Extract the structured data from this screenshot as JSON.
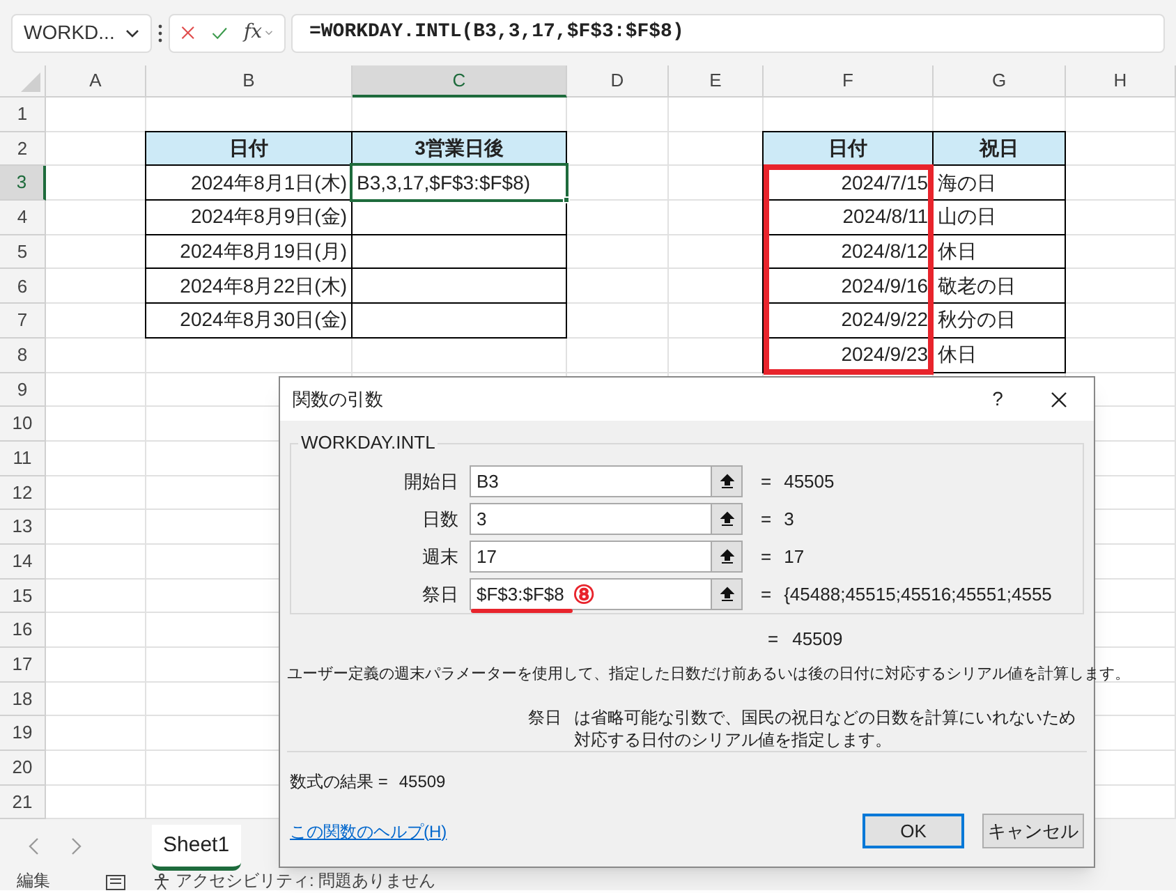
{
  "formula_bar": {
    "name_box": "WORKD...",
    "formula": "=WORKDAY.INTL(B3,3,17,$F$3:$F$8)",
    "function_button": "fx"
  },
  "columns": [
    {
      "label": "A",
      "selected": false
    },
    {
      "label": "B",
      "selected": false
    },
    {
      "label": "C",
      "selected": true
    },
    {
      "label": "D",
      "selected": false
    },
    {
      "label": "E",
      "selected": false
    },
    {
      "label": "F",
      "selected": false
    },
    {
      "label": "G",
      "selected": false
    },
    {
      "label": "H",
      "selected": false
    }
  ],
  "row_numbers": [
    {
      "label": "1",
      "selected": false
    },
    {
      "label": "2",
      "selected": false
    },
    {
      "label": "3",
      "selected": true
    },
    {
      "label": "4",
      "selected": false
    },
    {
      "label": "5",
      "selected": false
    },
    {
      "label": "6",
      "selected": false
    },
    {
      "label": "7",
      "selected": false
    },
    {
      "label": "8",
      "selected": false
    },
    {
      "label": "9",
      "selected": false
    },
    {
      "label": "10",
      "selected": false
    },
    {
      "label": "11",
      "selected": false
    },
    {
      "label": "12",
      "selected": false
    },
    {
      "label": "13",
      "selected": false
    },
    {
      "label": "14",
      "selected": false
    },
    {
      "label": "15",
      "selected": false
    },
    {
      "label": "16",
      "selected": false
    },
    {
      "label": "17",
      "selected": false
    },
    {
      "label": "18",
      "selected": false
    },
    {
      "label": "19",
      "selected": false
    },
    {
      "label": "20",
      "selected": false
    },
    {
      "label": "21",
      "selected": false
    }
  ],
  "date_table": {
    "columns": [
      "日付",
      "3営業日後"
    ],
    "rows": [
      [
        "2024年8月1日(木)",
        "B3,3,17,$F$3:$F$8)"
      ],
      [
        "2024年8月9日(金)",
        ""
      ],
      [
        "2024年8月19日(月)",
        ""
      ],
      [
        "2024年8月22日(木)",
        ""
      ],
      [
        "2024年8月30日(金)",
        ""
      ]
    ]
  },
  "holiday_table": {
    "columns": [
      "日付",
      "祝日"
    ],
    "rows": [
      [
        "2024/7/15",
        "海の日"
      ],
      [
        "2024/8/11",
        "山の日"
      ],
      [
        "2024/8/12",
        "休日"
      ],
      [
        "2024/9/16",
        "敬老の日"
      ],
      [
        "2024/9/22",
        "秋分の日"
      ],
      [
        "2024/9/23",
        "休日"
      ]
    ]
  },
  "dialog": {
    "title": "関数の引数",
    "help": "?",
    "function": "WORKDAY.INTL",
    "arguments": [
      {
        "label": "開始日",
        "value": "B3",
        "equals": "=",
        "result": "45505"
      },
      {
        "label": "日数",
        "value": "3",
        "equals": "=",
        "result": "3"
      },
      {
        "label": "週末",
        "value": "17",
        "equals": "=",
        "result": "17"
      },
      {
        "label": "祭日",
        "value": "$F$3:$F$8",
        "equals": "=",
        "result": "{45488;45515;45516;45551;4555",
        "callout": "⑧"
      }
    ],
    "result_equals": "=",
    "result_eq": "45509",
    "description": "ユーザー定義の週末パラメーターを使用して、指定した日数だけ前あるいは後の日付に対応するシリアル値を計算します。",
    "arg_label": "祭日",
    "arg_description": "は省略可能な引数で、国民の祝日などの日数を計算にいれないため対応する日付のシリアル値を指定します。",
    "formula_result_label": "数式の結果 =",
    "formula_result": "45509",
    "help_link": "この関数のヘルプ(H)",
    "buttons": [
      {
        "label": "OK",
        "default": true
      },
      {
        "label": "キャンセル",
        "default": false
      }
    ]
  },
  "sheet_tabs": [
    {
      "label": "Sheet1",
      "selected": true
    }
  ],
  "status_bar": {
    "mode": "編集",
    "accessibility": "アクセシビリティ: 問題ありません"
  }
}
